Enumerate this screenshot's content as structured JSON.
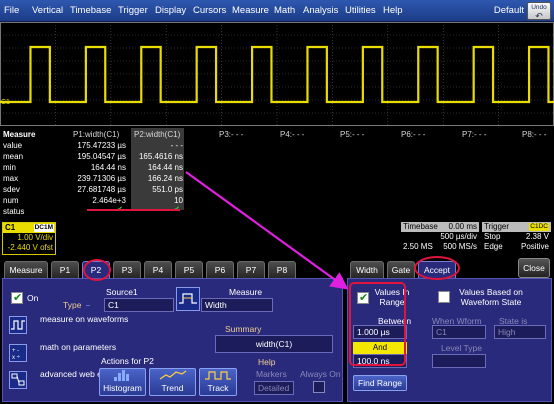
{
  "menu": {
    "items": [
      "File",
      "Vertical",
      "Timebase",
      "Trigger",
      "Display",
      "Cursors",
      "Measure",
      "Math",
      "Analysis",
      "Utilities",
      "Help"
    ],
    "default_label": "Default",
    "undo_label": "Undo"
  },
  "colors": {
    "trace_yellow": "#e8dc00",
    "panel_blue": "#2a2a7c",
    "annotation_red": "#e0143c",
    "arrow_magenta": "#e020e0"
  },
  "waveform": {
    "channel_marker": "C1",
    "period_us": 500,
    "duty_cycle_hint": 0.35
  },
  "measure_table": {
    "header_label": "Measure",
    "columns": [
      "P1:width(C1)",
      "P2:width(C1)",
      "P3:- - -",
      "P4:- - -",
      "P5:- - -",
      "P6:- - -",
      "P7:- - -",
      "P8:- - -"
    ],
    "row_labels": [
      "value",
      "mean",
      "min",
      "max",
      "sdev",
      "num",
      "status"
    ],
    "p1": [
      "175.47233 µs",
      "195.04547 µs",
      "164.44 ns",
      "239.71306 µs",
      "27.681748 µs",
      "2.464e+3",
      ""
    ],
    "p2": [
      "- - -",
      "165.4616 ns",
      "164.44 ns",
      "166.24 ns",
      "551.0 ps",
      "10",
      ""
    ],
    "status_mark": "✔"
  },
  "channel": {
    "name": "C1",
    "tag": "DC1M",
    "vdiv": "1.00 V/div",
    "offset": "-2.440 V ofst"
  },
  "timebase": {
    "title": "Timebase",
    "delay": "0.00 ms",
    "tdiv": "500 µs/div",
    "samples": "2.50 MS",
    "rate": "500 MS/s"
  },
  "trigger": {
    "title": "Trigger",
    "tag": "C1DC",
    "mode": "Stop",
    "level": "2.38 V",
    "type": "Edge",
    "slope": "Positive"
  },
  "tabs_left": [
    "Measure",
    "P1",
    "P2",
    "P3",
    "P4",
    "P5",
    "P6",
    "P7",
    "P8"
  ],
  "tabs_right": [
    "Width",
    "Gate",
    "Accept"
  ],
  "close_label": "Close",
  "left_panel": {
    "on_label": "On",
    "type_title": "Type",
    "types": [
      "measure on waveforms",
      "math on parameters",
      "advanced web edit"
    ],
    "source_label": "Source1",
    "source_value": "C1",
    "measure_label": "Measure",
    "measure_value": "Width",
    "summary_label": "Summary",
    "summary_value": "width(C1)",
    "actions_label": "Actions for P2",
    "actions": [
      "Histogram",
      "Trend",
      "Track"
    ],
    "help_label": "Help",
    "markers_label": "Markers",
    "markers_value": "Detailed",
    "always_on_label": "Always On"
  },
  "right_panel": {
    "values_in_range": "Values In Range",
    "between_label": "Between",
    "between_value": "1.000 µs",
    "and_label": "And",
    "and_value": "100.0 ns",
    "find_range": "Find Range",
    "values_based": "Values Based on Waveform State",
    "when_wform": "When Wform",
    "when_wform_value": "C1",
    "state_is": "State is",
    "state_is_value": "High",
    "level_type": "Level Type"
  }
}
